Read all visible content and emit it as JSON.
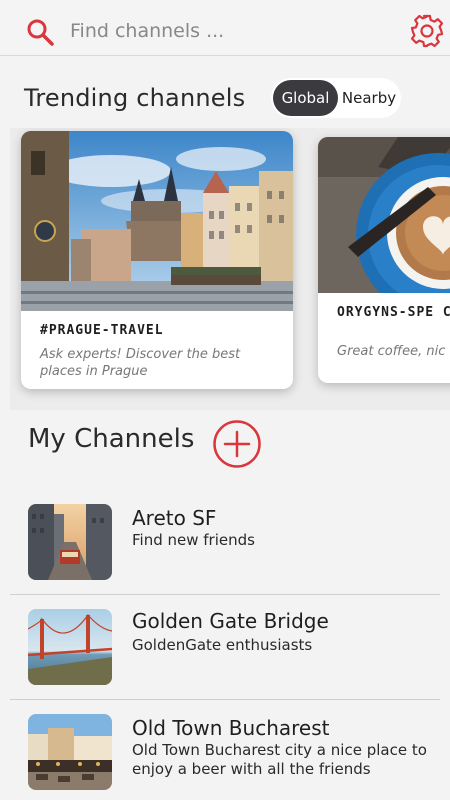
{
  "search": {
    "placeholder": "Find channels ...",
    "value": ""
  },
  "icons": {
    "search": "search-icon",
    "settings": "gear-icon",
    "add": "plus-circle-icon"
  },
  "colors": {
    "accent": "#d9363e",
    "toggle_active": "#3a3a3f"
  },
  "trending": {
    "title": "Trending channels",
    "toggle": {
      "options": [
        "Global",
        "Nearby"
      ],
      "selected": "Global"
    },
    "cards": [
      {
        "title": "#PRAGUE-TRAVEL",
        "description": "Ask experts! Discover the best places in Prague"
      },
      {
        "title": "ORYGYNS-SPE COFFEE",
        "description": "Great coffee, nic more"
      }
    ]
  },
  "my_channels": {
    "title": "My Channels",
    "items": [
      {
        "name": "Areto SF",
        "description": "Find new friends"
      },
      {
        "name": "Golden Gate Bridge",
        "description": "GoldenGate enthusiasts"
      },
      {
        "name": "Old Town Bucharest",
        "description": "Old Town Bucharest city a nice place to enjoy a beer with all the friends"
      }
    ]
  }
}
